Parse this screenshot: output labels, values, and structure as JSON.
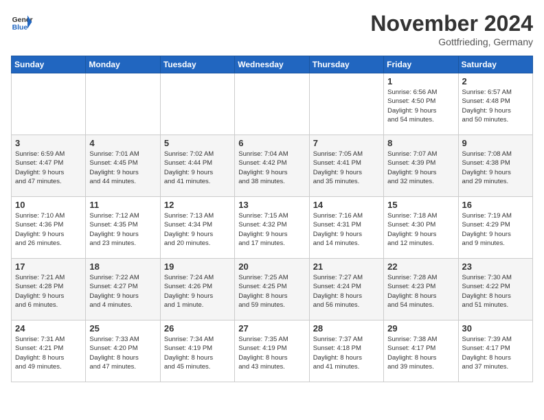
{
  "header": {
    "logo_line1": "General",
    "logo_line2": "Blue",
    "month": "November 2024",
    "location": "Gottfrieding, Germany"
  },
  "days_of_week": [
    "Sunday",
    "Monday",
    "Tuesday",
    "Wednesday",
    "Thursday",
    "Friday",
    "Saturday"
  ],
  "weeks": [
    [
      {
        "day": "",
        "info": ""
      },
      {
        "day": "",
        "info": ""
      },
      {
        "day": "",
        "info": ""
      },
      {
        "day": "",
        "info": ""
      },
      {
        "day": "",
        "info": ""
      },
      {
        "day": "1",
        "info": "Sunrise: 6:56 AM\nSunset: 4:50 PM\nDaylight: 9 hours\nand 54 minutes."
      },
      {
        "day": "2",
        "info": "Sunrise: 6:57 AM\nSunset: 4:48 PM\nDaylight: 9 hours\nand 50 minutes."
      }
    ],
    [
      {
        "day": "3",
        "info": "Sunrise: 6:59 AM\nSunset: 4:47 PM\nDaylight: 9 hours\nand 47 minutes."
      },
      {
        "day": "4",
        "info": "Sunrise: 7:01 AM\nSunset: 4:45 PM\nDaylight: 9 hours\nand 44 minutes."
      },
      {
        "day": "5",
        "info": "Sunrise: 7:02 AM\nSunset: 4:44 PM\nDaylight: 9 hours\nand 41 minutes."
      },
      {
        "day": "6",
        "info": "Sunrise: 7:04 AM\nSunset: 4:42 PM\nDaylight: 9 hours\nand 38 minutes."
      },
      {
        "day": "7",
        "info": "Sunrise: 7:05 AM\nSunset: 4:41 PM\nDaylight: 9 hours\nand 35 minutes."
      },
      {
        "day": "8",
        "info": "Sunrise: 7:07 AM\nSunset: 4:39 PM\nDaylight: 9 hours\nand 32 minutes."
      },
      {
        "day": "9",
        "info": "Sunrise: 7:08 AM\nSunset: 4:38 PM\nDaylight: 9 hours\nand 29 minutes."
      }
    ],
    [
      {
        "day": "10",
        "info": "Sunrise: 7:10 AM\nSunset: 4:36 PM\nDaylight: 9 hours\nand 26 minutes."
      },
      {
        "day": "11",
        "info": "Sunrise: 7:12 AM\nSunset: 4:35 PM\nDaylight: 9 hours\nand 23 minutes."
      },
      {
        "day": "12",
        "info": "Sunrise: 7:13 AM\nSunset: 4:34 PM\nDaylight: 9 hours\nand 20 minutes."
      },
      {
        "day": "13",
        "info": "Sunrise: 7:15 AM\nSunset: 4:32 PM\nDaylight: 9 hours\nand 17 minutes."
      },
      {
        "day": "14",
        "info": "Sunrise: 7:16 AM\nSunset: 4:31 PM\nDaylight: 9 hours\nand 14 minutes."
      },
      {
        "day": "15",
        "info": "Sunrise: 7:18 AM\nSunset: 4:30 PM\nDaylight: 9 hours\nand 12 minutes."
      },
      {
        "day": "16",
        "info": "Sunrise: 7:19 AM\nSunset: 4:29 PM\nDaylight: 9 hours\nand 9 minutes."
      }
    ],
    [
      {
        "day": "17",
        "info": "Sunrise: 7:21 AM\nSunset: 4:28 PM\nDaylight: 9 hours\nand 6 minutes."
      },
      {
        "day": "18",
        "info": "Sunrise: 7:22 AM\nSunset: 4:27 PM\nDaylight: 9 hours\nand 4 minutes."
      },
      {
        "day": "19",
        "info": "Sunrise: 7:24 AM\nSunset: 4:26 PM\nDaylight: 9 hours\nand 1 minute."
      },
      {
        "day": "20",
        "info": "Sunrise: 7:25 AM\nSunset: 4:25 PM\nDaylight: 8 hours\nand 59 minutes."
      },
      {
        "day": "21",
        "info": "Sunrise: 7:27 AM\nSunset: 4:24 PM\nDaylight: 8 hours\nand 56 minutes."
      },
      {
        "day": "22",
        "info": "Sunrise: 7:28 AM\nSunset: 4:23 PM\nDaylight: 8 hours\nand 54 minutes."
      },
      {
        "day": "23",
        "info": "Sunrise: 7:30 AM\nSunset: 4:22 PM\nDaylight: 8 hours\nand 51 minutes."
      }
    ],
    [
      {
        "day": "24",
        "info": "Sunrise: 7:31 AM\nSunset: 4:21 PM\nDaylight: 8 hours\nand 49 minutes."
      },
      {
        "day": "25",
        "info": "Sunrise: 7:33 AM\nSunset: 4:20 PM\nDaylight: 8 hours\nand 47 minutes."
      },
      {
        "day": "26",
        "info": "Sunrise: 7:34 AM\nSunset: 4:19 PM\nDaylight: 8 hours\nand 45 minutes."
      },
      {
        "day": "27",
        "info": "Sunrise: 7:35 AM\nSunset: 4:19 PM\nDaylight: 8 hours\nand 43 minutes."
      },
      {
        "day": "28",
        "info": "Sunrise: 7:37 AM\nSunset: 4:18 PM\nDaylight: 8 hours\nand 41 minutes."
      },
      {
        "day": "29",
        "info": "Sunrise: 7:38 AM\nSunset: 4:17 PM\nDaylight: 8 hours\nand 39 minutes."
      },
      {
        "day": "30",
        "info": "Sunrise: 7:39 AM\nSunset: 4:17 PM\nDaylight: 8 hours\nand 37 minutes."
      }
    ]
  ]
}
